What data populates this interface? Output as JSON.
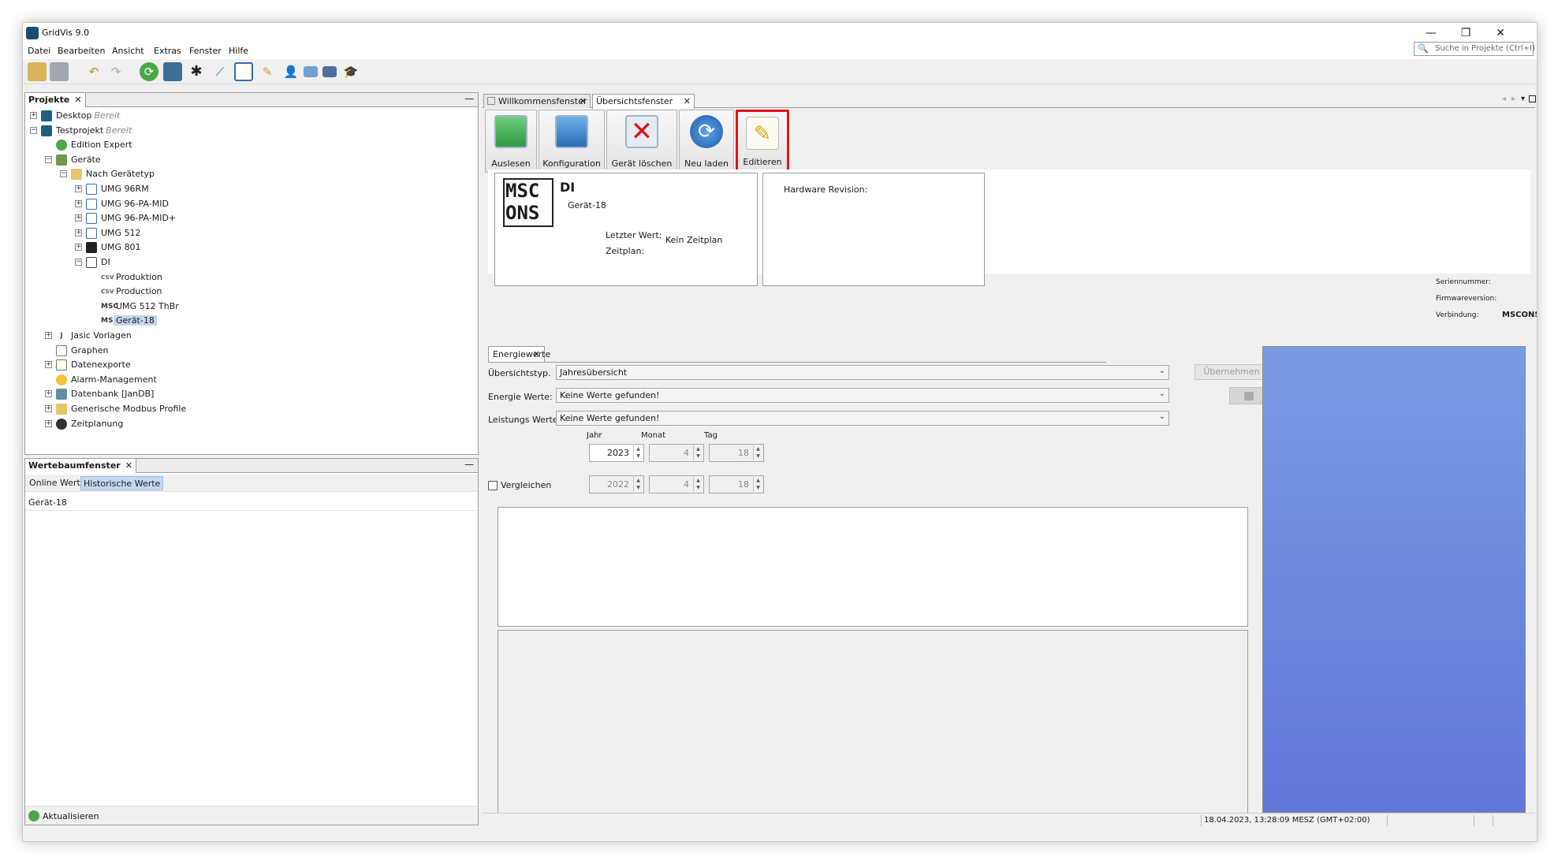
{
  "window": {
    "title": "GridVis 9.0",
    "controls": {
      "minimize": "—",
      "restore": "❐",
      "close": "✕"
    }
  },
  "menu": [
    "Datei",
    "Bearbeiten",
    "Ansicht",
    "Extras",
    "Fenster",
    "Hilfe"
  ],
  "search": {
    "placeholder": "Suche in Projekte (Ctrl+I)"
  },
  "toolbar_icons": [
    "open-project-icon",
    "save-icon",
    "undo-icon",
    "redo-icon",
    "refresh-icon",
    "device-icon",
    "topology-icon",
    "graph-icon",
    "export-icon",
    "tools-icon",
    "user-icon",
    "monitor-icon",
    "display-icon",
    "academy-icon"
  ],
  "projects_panel": {
    "tab": "Projekte",
    "tree": [
      {
        "label": "Desktop",
        "status": "Bereit",
        "depth": 0,
        "toggle": "+",
        "icon": "project-icon"
      },
      {
        "label": "Testprojekt",
        "status": "Bereit",
        "depth": 0,
        "toggle": "−",
        "icon": "project-icon"
      },
      {
        "label": "Edition Expert",
        "status": "",
        "depth": 1,
        "toggle": "",
        "icon": "check-icon"
      },
      {
        "label": "Geräte",
        "status": "",
        "depth": 1,
        "toggle": "−",
        "icon": "devices-icon"
      },
      {
        "label": "Nach Gerätetyp",
        "status": "",
        "depth": 2,
        "toggle": "−",
        "icon": "folder-icon"
      },
      {
        "label": "UMG 96RM",
        "status": "",
        "depth": 3,
        "toggle": "+",
        "icon": "meter-icon"
      },
      {
        "label": "UMG 96-PA-MID",
        "status": "",
        "depth": 3,
        "toggle": "+",
        "icon": "meter-icon"
      },
      {
        "label": "UMG 96-PA-MID+",
        "status": "",
        "depth": 3,
        "toggle": "+",
        "icon": "meter-icon"
      },
      {
        "label": "UMG 512",
        "status": "",
        "depth": 3,
        "toggle": "+",
        "icon": "meter-icon"
      },
      {
        "label": "UMG 801",
        "status": "",
        "depth": 3,
        "toggle": "+",
        "icon": "meter-dark-icon"
      },
      {
        "label": "DI",
        "status": "",
        "depth": 3,
        "toggle": "−",
        "icon": "di-icon"
      },
      {
        "label": "Produktion",
        "status": "",
        "depth": 4,
        "toggle": "",
        "icon": "csv-icon"
      },
      {
        "label": "Production",
        "status": "",
        "depth": 4,
        "toggle": "",
        "icon": "csv-icon"
      },
      {
        "label": "UMG  512 ThBr",
        "status": "",
        "depth": 4,
        "toggle": "",
        "icon": "mscons-icon"
      },
      {
        "label": "Gerät-18",
        "status": "",
        "depth": 4,
        "toggle": "",
        "icon": "mscons-icon",
        "selected": true
      },
      {
        "label": "Jasic Vorlagen",
        "status": "",
        "depth": 1,
        "toggle": "+",
        "icon": "jasic-icon"
      },
      {
        "label": "Graphen",
        "status": "",
        "depth": 1,
        "toggle": "",
        "icon": "graph-icon"
      },
      {
        "label": "Datenexporte",
        "status": "",
        "depth": 1,
        "toggle": "+",
        "icon": "export-icon"
      },
      {
        "label": "Alarm-Management",
        "status": "",
        "depth": 1,
        "toggle": "",
        "icon": "alarm-icon"
      },
      {
        "label": "Datenbank [JanDB]",
        "status": "",
        "depth": 1,
        "toggle": "+",
        "icon": "database-icon"
      },
      {
        "label": "Generische Modbus Profile",
        "status": "",
        "depth": 1,
        "toggle": "+",
        "icon": "folder-icon"
      },
      {
        "label": "Zeitplanung",
        "status": "",
        "depth": 1,
        "toggle": "+",
        "icon": "schedule-icon"
      }
    ]
  },
  "values_panel": {
    "tab": "Wertebaumfenster",
    "subtabs": [
      "Online Werte",
      "Historische Werte"
    ],
    "active_subtab": "Historische Werte",
    "item": "Gerät-18",
    "refresh": "Aktualisieren"
  },
  "editor_tabs": [
    {
      "label": "Willkommensfenster",
      "active": false
    },
    {
      "label": "Übersichtsfenster",
      "active": true
    }
  ],
  "action_buttons": [
    {
      "label": "Auslesen",
      "icon": "read-icon"
    },
    {
      "label": "Konfiguration",
      "icon": "config-icon"
    },
    {
      "label": "Gerät löschen",
      "icon": "delete-icon"
    },
    {
      "label": "Neu laden",
      "icon": "reload-icon"
    },
    {
      "label": "Editieren",
      "icon": "edit-icon",
      "highlighted": true
    }
  ],
  "device_info": {
    "logo_line1": "MSC",
    "logo_line2": "ONS",
    "name": "DI",
    "sub": "Gerät-18",
    "last_value_label": "Letzter Wert:",
    "schedule_label": "Zeitplan:",
    "schedule_value": "Kein Zeitplan",
    "hardware_revision_label": "Hardware Revision:",
    "serial_label": "Seriennummer:",
    "firmware_label": "Firmwareversion:",
    "connection_label": "Verbindung:",
    "connection_value": "MSCONS"
  },
  "energy": {
    "tab": "Energiewerte",
    "overview_label": "Übersichtstyp.",
    "overview_value": "Jahresübersicht",
    "apply_label": "Übernehmen",
    "energy_label": "Energie Werte:",
    "energy_value": "Keine Werte gefunden!",
    "power_label": "Leistungs Werte:",
    "power_value": "Keine Werte gefunden!",
    "col_year": "Jahr",
    "col_month": "Monat",
    "col_day": "Tag",
    "year": "2023",
    "month": "4",
    "day": "18",
    "compare_label": "Vergleichen",
    "compare_year": "2022",
    "compare_month": "4",
    "compare_day": "18"
  },
  "statusbar": {
    "datetime": "18.04.2023, 13:28:09 MESZ (GMT+02:00)"
  },
  "colors": {
    "highlight": "#e0141b",
    "selection": "#c3d9f2",
    "blue_panel_top": "#7b9be3",
    "blue_panel_bottom": "#6276d8"
  }
}
